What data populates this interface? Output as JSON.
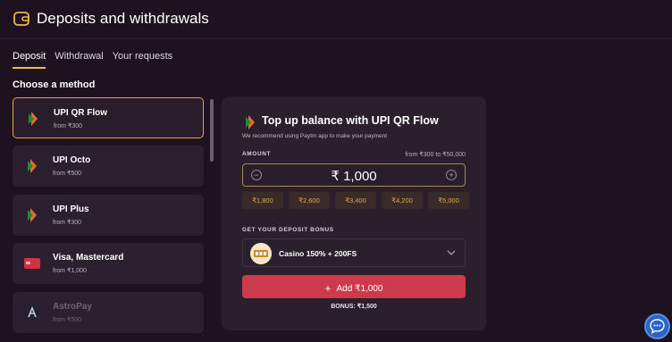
{
  "header": {
    "title": "Deposits and withdrawals",
    "icon": "wallet-icon"
  },
  "tabs": [
    {
      "label": "Deposit",
      "active": true
    },
    {
      "label": "Withdrawal",
      "active": false
    },
    {
      "label": "Your requests",
      "active": false
    }
  ],
  "choose_label": "Choose a method",
  "methods": [
    {
      "name": "UPI QR Flow",
      "sub": "from ₹300",
      "icon": "upi-icon",
      "selected": true
    },
    {
      "name": "UPI Octo",
      "sub": "from ₹500",
      "icon": "upi-icon"
    },
    {
      "name": "UPI Plus",
      "sub": "from ₹300",
      "icon": "upi-icon"
    },
    {
      "name": "Visa, Mastercard",
      "sub": "from ₹1,000",
      "icon": "card-icon"
    },
    {
      "name": "AstroPay",
      "sub": "from ₹500",
      "icon": "astropay-icon"
    }
  ],
  "panel": {
    "title": "Top up balance with UPI QR Flow",
    "subtitle": "We recommend using Paytm app to make your payment",
    "amount_label": "AMOUNT",
    "range": "from ₹300 to ₹50,000",
    "amount": "₹ 1,000",
    "presets": [
      "₹1,800",
      "₹2,600",
      "₹3,400",
      "₹4,200",
      "₹5,000"
    ],
    "bonus_label": "GET YOUR DEPOSIT BONUS",
    "bonus_option": "Casino 150% + 200FS",
    "add_button": "Add ₹1,000",
    "bonus_total": "BONUS: ₹1,500"
  },
  "colors": {
    "accent": "#f2b744",
    "button": "#cd3a4d",
    "background": "#1e1221"
  }
}
